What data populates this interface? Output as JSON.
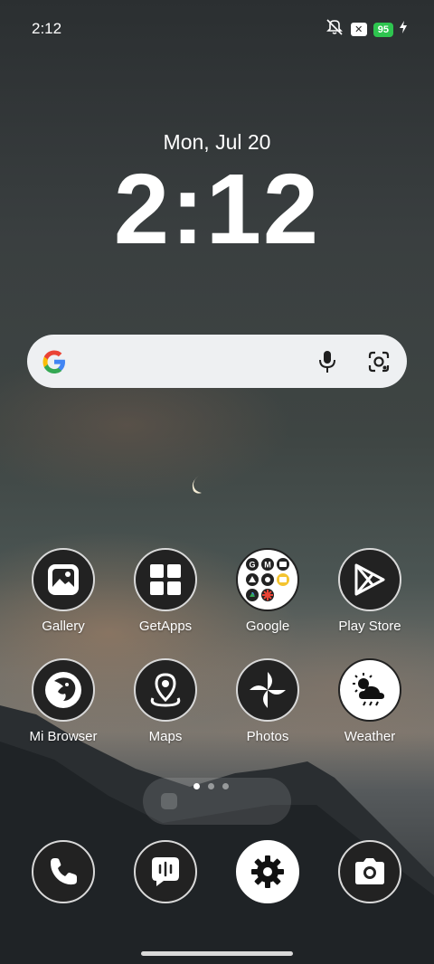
{
  "status_bar": {
    "time": "2:12",
    "battery": "95"
  },
  "lockclock": {
    "date": "Mon, Jul 20",
    "time": "2:12"
  },
  "apps_row1": [
    {
      "label": "Gallery",
      "icon": "gallery-icon"
    },
    {
      "label": "GetApps",
      "icon": "getapps-icon"
    },
    {
      "label": "Google",
      "icon": "google-folder-icon"
    },
    {
      "label": "Play Store",
      "icon": "play-store-icon"
    }
  ],
  "apps_row2": [
    {
      "label": "Mi Browser",
      "icon": "browser-icon"
    },
    {
      "label": "Maps",
      "icon": "maps-icon"
    },
    {
      "label": "Photos",
      "icon": "photos-icon"
    },
    {
      "label": "Weather",
      "icon": "weather-icon"
    }
  ],
  "dock": [
    {
      "icon": "phone-icon"
    },
    {
      "icon": "messages-icon"
    },
    {
      "icon": "settings-icon"
    },
    {
      "icon": "camera-icon"
    }
  ],
  "page_indicator": {
    "pages": 3,
    "active": 0
  },
  "colors": {
    "battery": "#2ec44f",
    "search_bg": "#eef0f2"
  }
}
